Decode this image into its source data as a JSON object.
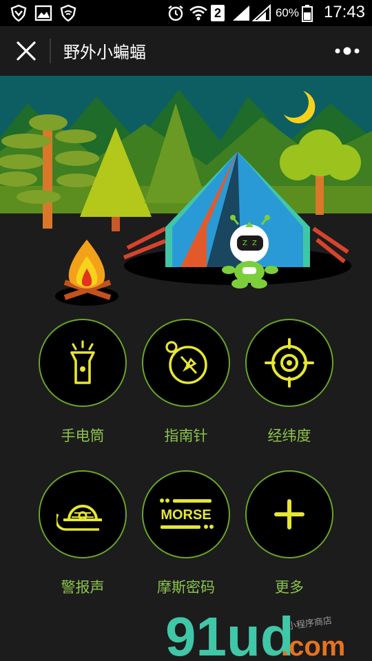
{
  "status_bar": {
    "sim_slot": "2",
    "battery_percent": "60%",
    "time": "17:43"
  },
  "nav": {
    "title": "野外小蝙蝠"
  },
  "tools": [
    {
      "label": "手电筒",
      "icon": "flashlight-icon"
    },
    {
      "label": "指南针",
      "icon": "compass-icon"
    },
    {
      "label": "经纬度",
      "icon": "crosshair-icon"
    },
    {
      "label": "警报声",
      "icon": "siren-icon"
    },
    {
      "label": "摩斯密码",
      "icon": "morse-icon",
      "icon_text": "MORSE"
    },
    {
      "label": "更多",
      "icon": "plus-icon"
    }
  ],
  "colors": {
    "accent": "#e6e635",
    "label": "#8bc34a",
    "ring": "#6aa628",
    "sky": "#0c5e63"
  },
  "watermark": {
    "main": "91ud",
    "suffix": ".com",
    "tagline": "小程序商店"
  }
}
